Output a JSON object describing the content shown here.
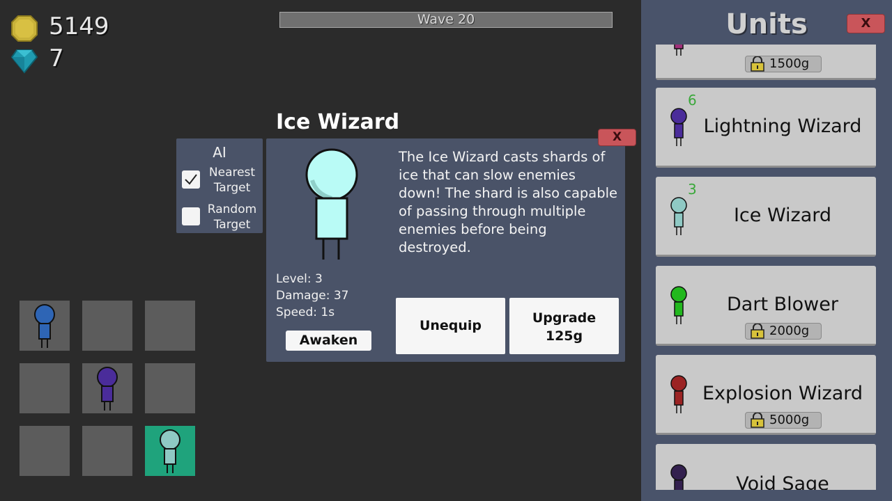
{
  "currency": {
    "gold": "5149",
    "gems": "7"
  },
  "wave": {
    "label": "Wave 20"
  },
  "ai_panel": {
    "title": "AI",
    "options": [
      {
        "label_line1": "Nearest",
        "label_line2": "Target",
        "checked": true
      },
      {
        "label_line1": "Random",
        "label_line2": "Target",
        "checked": false
      }
    ]
  },
  "unit_detail": {
    "name": "Ice Wizard",
    "description": "The Ice Wizard casts shards of ice that can slow enemies down! The shard is also capable of passing through multiple enemies before being destroyed.",
    "level": "Level: 3",
    "damage": "Damage: 37",
    "speed": "Speed: 1s",
    "awaken_label": "Awaken",
    "unequip_label": "Unequip",
    "upgrade_label_line1": "Upgrade",
    "upgrade_label_line2": "125g",
    "close_label": "X"
  },
  "shop": {
    "title": "Units",
    "close_label": "X",
    "units": [
      {
        "name": "",
        "level": "",
        "price": "1500g",
        "locked": true
      },
      {
        "name": "Lightning Wizard",
        "level": "6",
        "price": "",
        "locked": false
      },
      {
        "name": "Ice Wizard",
        "level": "3",
        "price": "",
        "locked": false
      },
      {
        "name": "Dart Blower",
        "level": "",
        "price": "2000g",
        "locked": true
      },
      {
        "name": "Explosion Wizard",
        "level": "",
        "price": "5000g",
        "locked": true
      },
      {
        "name": "Void Sage",
        "level": "",
        "price": "",
        "locked": false
      }
    ]
  },
  "colors": {
    "blue_unit": "#2e65b5",
    "purple_unit": "#4a2c9a",
    "ice_unit": "#8fc9c4",
    "green_unit": "#22b81e",
    "red_unit": "#9b2323",
    "void_unit": "#33204e",
    "selected_slot": "#1fa37c"
  }
}
